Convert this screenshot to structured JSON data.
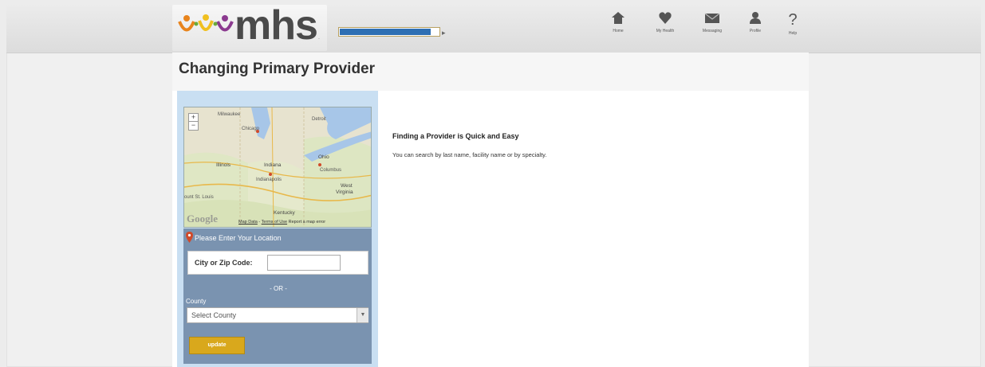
{
  "header": {
    "logo_text": "mhs",
    "logo_tm": ".",
    "progress": 0.92,
    "nav": [
      {
        "label": "Home",
        "icon": "home-icon"
      },
      {
        "label": "My Health",
        "icon": "heart-icon"
      },
      {
        "label": "Messaging",
        "icon": "envelope-icon"
      },
      {
        "label": "Profile",
        "icon": "person-icon"
      },
      {
        "label": "Help",
        "icon": "question-icon"
      }
    ]
  },
  "page": {
    "title": "Changing Primary Provider"
  },
  "map": {
    "places": {
      "milwaukee": "Milwaukee",
      "chicago": "Chicago",
      "detroit": "Detroit",
      "ohio": "Ohio",
      "illinois": "Illinois",
      "indiana": "Indiana",
      "columbus": "Columbus",
      "indianapolis": "Indianapolis",
      "west_virginia_1": "West",
      "west_virginia_2": "Virginia",
      "st_louis": "ount St. Louis",
      "kentucky": "Kentucky"
    },
    "google": "Google",
    "map_data": "Map Data",
    "terms": "Terms of Use",
    "report": "Report a map error"
  },
  "location_form": {
    "title": "Please Enter Your Location",
    "zip_label": "City or Zip Code:",
    "zip_value": "",
    "or_text": "- OR -",
    "county_label": "County",
    "county_selected": "Select County",
    "update_label": "update"
  },
  "main": {
    "heading": "Finding a Provider is Quick and Easy",
    "description": "You can search by last name, facility name or by specialty."
  },
  "colors": {
    "accent_blue": "#2e6fb3",
    "panel_blue": "#7a93b0",
    "sidebar_light": "#c9dff2",
    "button_gold": "#d9a81c",
    "logo_orange": "#e8841c",
    "logo_yellow": "#f0c020",
    "logo_purple": "#8b3a8f"
  }
}
